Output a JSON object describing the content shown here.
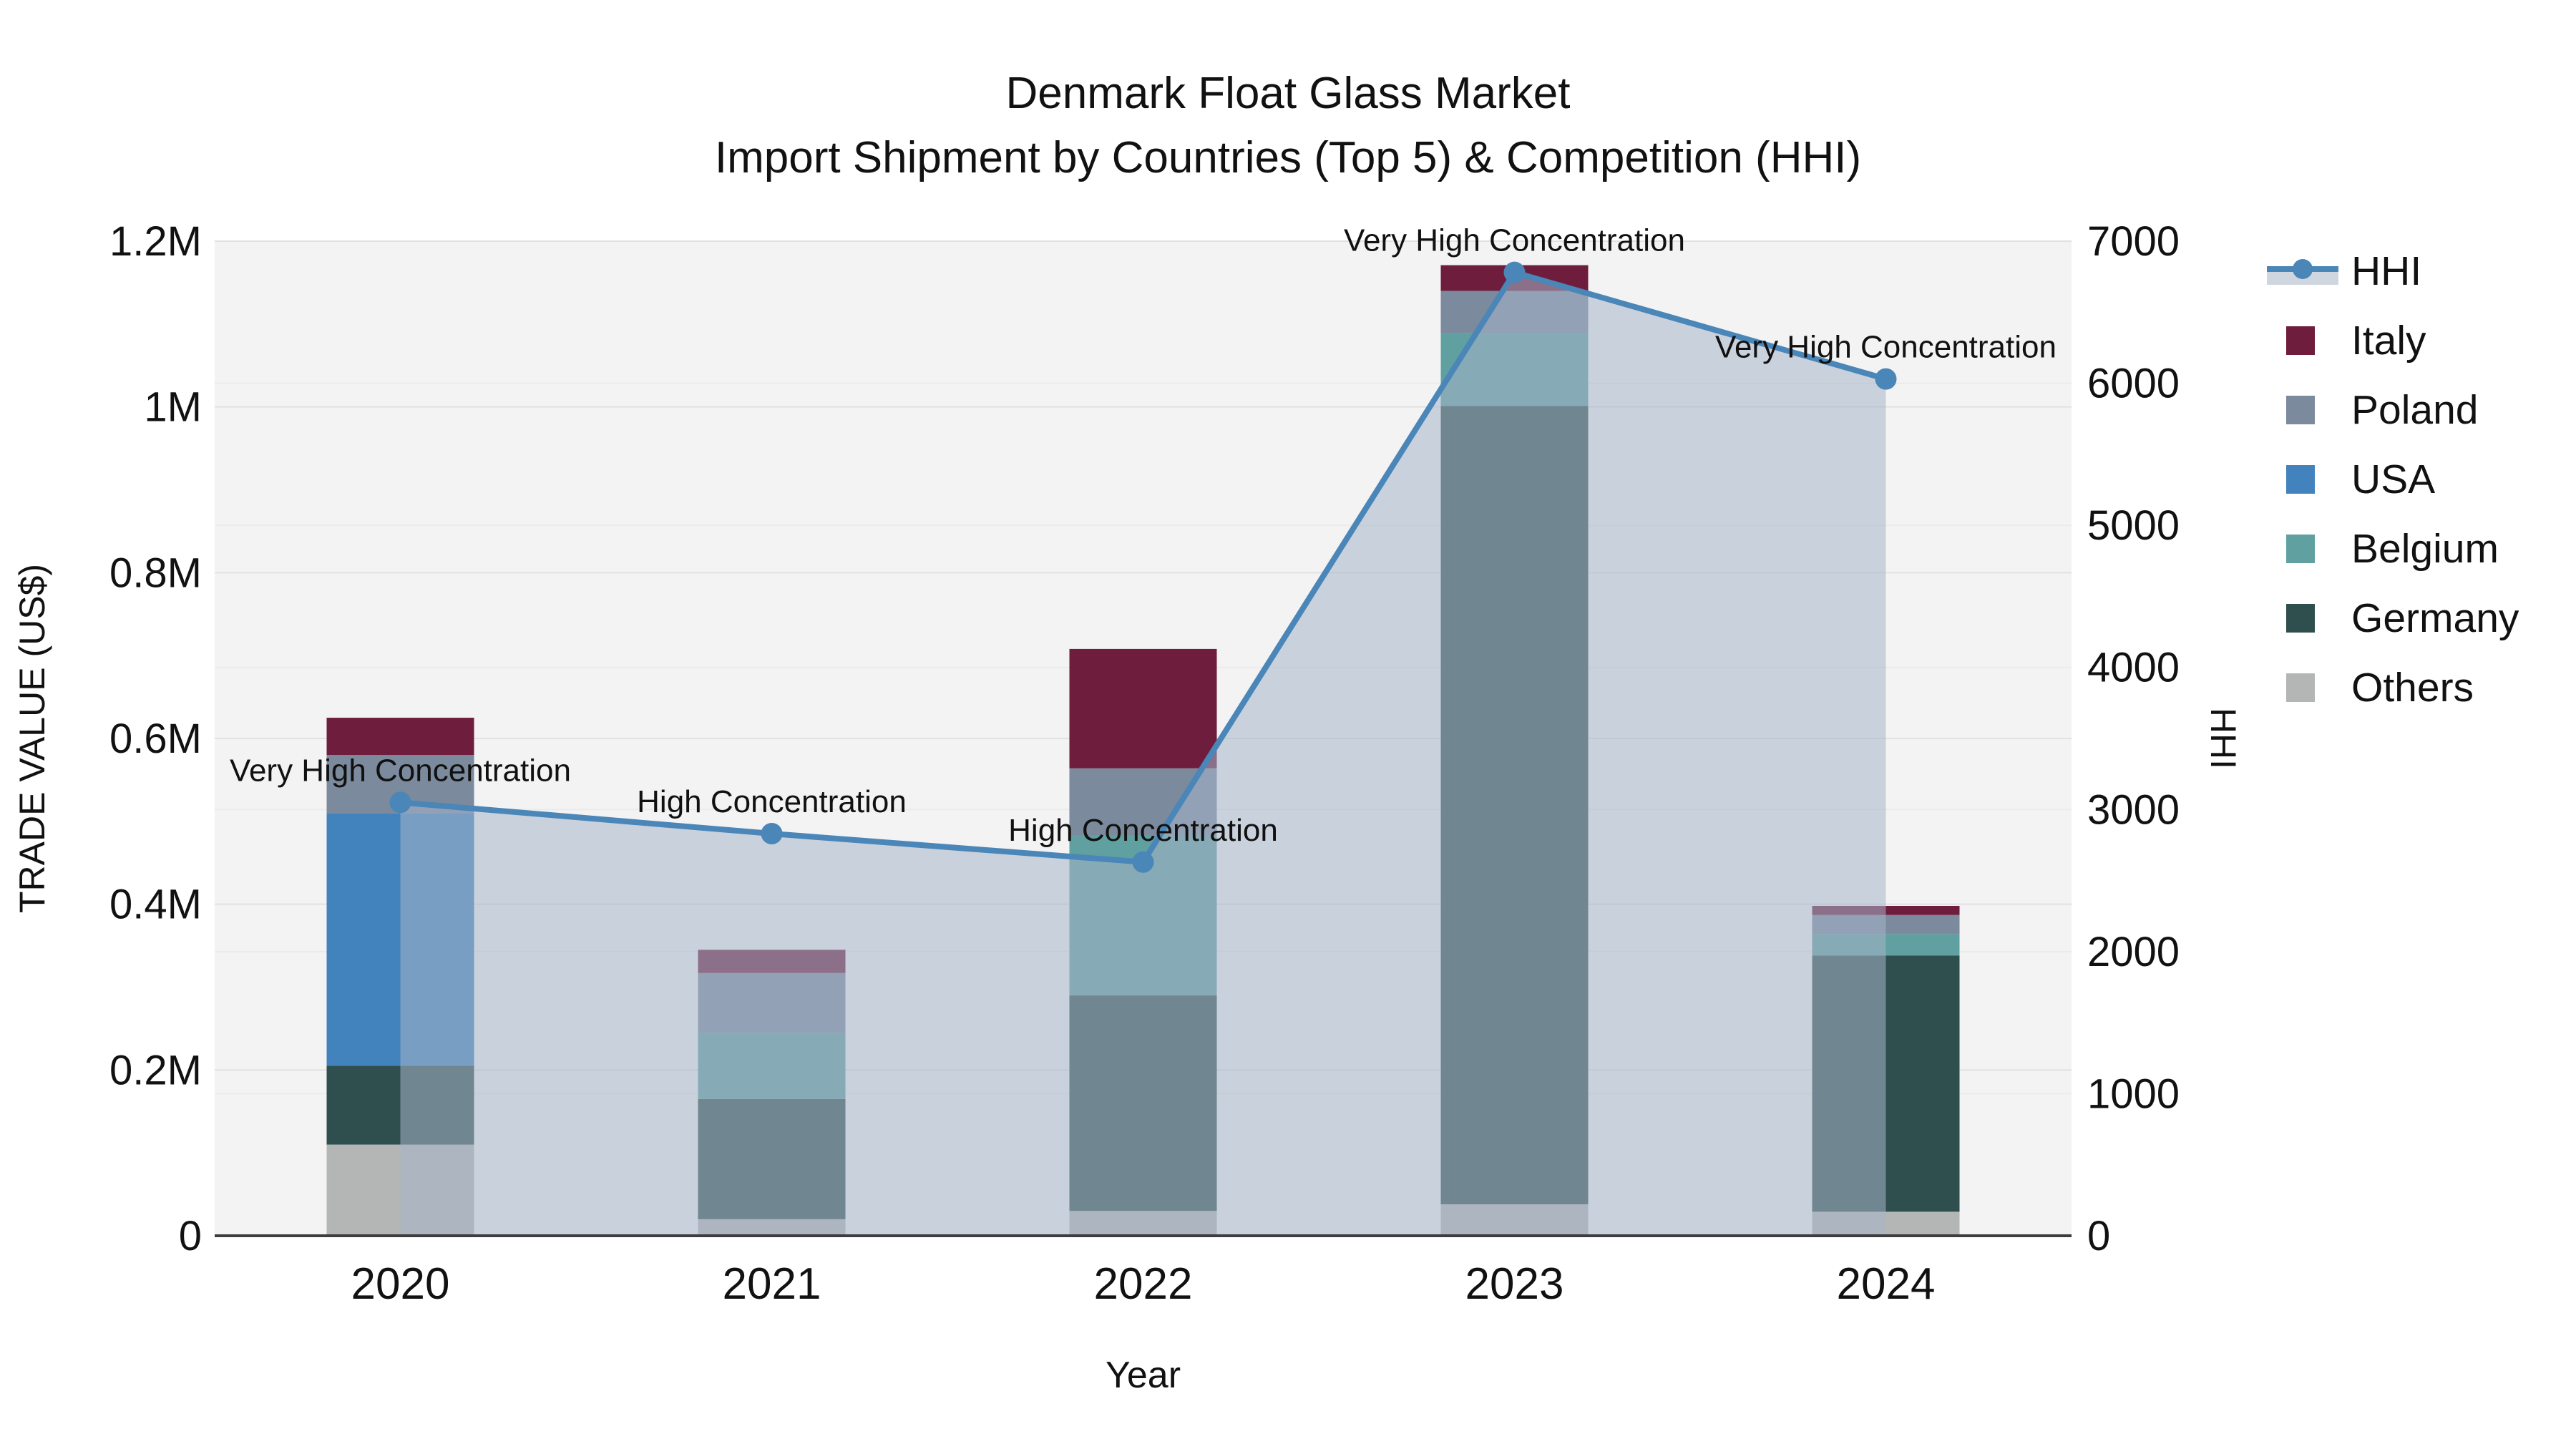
{
  "chart_data": {
    "type": "combo_stacked_bar_line",
    "title": "Denmark Float Glass Market",
    "subtitle": "Import Shipment by Countries (Top 5) & Competition (HHI)",
    "xlabel": "Year",
    "ylabel_left": "TRADE VALUE (US$)",
    "ylabel_right": "HHI",
    "categories": [
      "2020",
      "2021",
      "2022",
      "2023",
      "2024"
    ],
    "bar_unit": "US$",
    "series": [
      {
        "name": "Others",
        "color": "#b4b6b6",
        "values": [
          110000,
          20000,
          30000,
          38000,
          29000
        ]
      },
      {
        "name": "Germany",
        "color": "#2f4f4f",
        "values": [
          95000,
          145000,
          260000,
          963000,
          309000
        ]
      },
      {
        "name": "Belgium",
        "color": "#61a0a0",
        "values": [
          0,
          80000,
          193000,
          88000,
          26000
        ]
      },
      {
        "name": "USA",
        "color": "#4283bd",
        "values": [
          305000,
          0,
          0,
          0,
          0
        ]
      },
      {
        "name": "Poland",
        "color": "#7b8a9d",
        "values": [
          70000,
          72000,
          81000,
          51000,
          23000
        ]
      },
      {
        "name": "Italy",
        "color": "#6e1e3c",
        "values": [
          45000,
          28000,
          144000,
          31000,
          11000
        ]
      }
    ],
    "bar_totals": [
      625000,
      345000,
      708000,
      1171000,
      398000
    ],
    "line": {
      "name": "HHI",
      "color": "#4a86b8",
      "fill_color": "rgba(166,180,200,0.55)",
      "values": [
        3050,
        2830,
        2630,
        6780,
        6030
      ],
      "annotations": [
        "Very High Concentration",
        "High Concentration",
        "High Concentration",
        "Very High Concentration",
        "Very High Concentration"
      ]
    },
    "yaxis_left": {
      "min": 0,
      "max": 1200000,
      "tick_values": [
        0,
        200000,
        400000,
        600000,
        800000,
        1000000,
        1200000
      ],
      "tick_labels": [
        "0",
        "0.2M",
        "0.4M",
        "0.6M",
        "0.8M",
        "1M",
        "1.2M"
      ]
    },
    "yaxis_right": {
      "min": 0,
      "max": 7000,
      "tick_values": [
        0,
        1000,
        2000,
        3000,
        4000,
        5000,
        6000,
        7000
      ],
      "tick_labels": [
        "0",
        "1000",
        "2000",
        "3000",
        "4000",
        "5000",
        "6000",
        "7000"
      ]
    },
    "grid": true,
    "legend_position": "right",
    "legend": {
      "items": [
        {
          "label": "HHI",
          "color": "#4a86b8",
          "kind": "line"
        },
        {
          "label": "Italy",
          "color": "#6e1e3c",
          "kind": "square"
        },
        {
          "label": "Poland",
          "color": "#7b8a9d",
          "kind": "square"
        },
        {
          "label": "USA",
          "color": "#4283bd",
          "kind": "square"
        },
        {
          "label": "Belgium",
          "color": "#61a0a0",
          "kind": "square"
        },
        {
          "label": "Germany",
          "color": "#2f4f4f",
          "kind": "square"
        },
        {
          "label": "Others",
          "color": "#b4b6b6",
          "kind": "square"
        }
      ]
    },
    "style": {
      "plot_bg": "#f3f3f3",
      "grid_left": "#e1e1e1",
      "grid_right": "#ebebeb",
      "axis_line": "#3d3d3d",
      "text": "#111111"
    }
  }
}
